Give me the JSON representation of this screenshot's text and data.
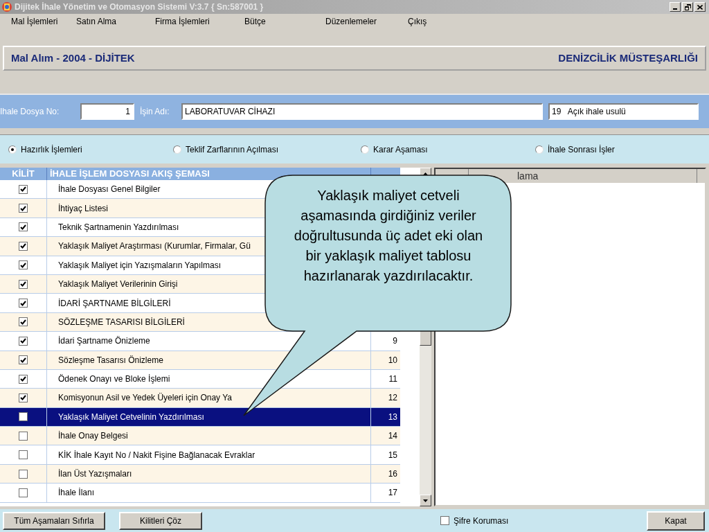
{
  "window": {
    "title": "Dijitek İhale Yönetim ve Otomasyon Sistemi V:3.7 { Sn:587001 }"
  },
  "menu": [
    "Mal İşlemleri",
    "Satın Alma",
    "Firma İşlemleri",
    "Bütçe",
    "Düzenlemeler",
    "Çıkış"
  ],
  "header": {
    "left": "Mal Alım - 2004 - DİJİTEK",
    "right": "DENİZCİLİK MÜSTEŞARLIĞI"
  },
  "fields": [
    {
      "label": "Ihale Dosya No:",
      "value": "1"
    },
    {
      "label": "İşin Adı:",
      "value": "LABORATUVAR CİHAZI"
    },
    {
      "value": "19   Açık ihale usulü"
    }
  ],
  "phases": [
    {
      "label": "Hazırlık İşlemleri",
      "selected": true
    },
    {
      "label": "Teklif Zarflarının Açılması",
      "selected": false
    },
    {
      "label": "Karar Aşaması",
      "selected": false
    },
    {
      "label": "İhale Sonrası İşler",
      "selected": false
    }
  ],
  "table": {
    "columns": [
      "KİLİT",
      "İHALE İŞLEM DOSYASI AKIŞ ŞEMASI"
    ],
    "rows": [
      {
        "checked": true,
        "selected": false,
        "title": "İhale Dosyası Genel Bilgiler"
      },
      {
        "checked": true,
        "selected": false,
        "title": "İhtiyaç Listesi"
      },
      {
        "checked": true,
        "selected": false,
        "title": "Teknik Şartnamenin Yazdırılması"
      },
      {
        "checked": true,
        "selected": false,
        "title": "Yaklaşık Maliyet Araştırması (Kurumlar, Firmalar, Gü"
      },
      {
        "checked": true,
        "selected": false,
        "title": "Yaklaşık Maliyet için Yazışmaların Yapılması"
      },
      {
        "checked": true,
        "selected": false,
        "title": "Yaklaşık Maliyet Verilerinin Girişi"
      },
      {
        "checked": true,
        "selected": false,
        "title": "İDARİ ŞARTNAME BİLGİLERİ"
      },
      {
        "checked": true,
        "selected": false,
        "title": "SÖZLEŞME TASARISI BİLGİLERİ"
      },
      {
        "checked": true,
        "selected": false,
        "title": "İdari Şartname Önizleme",
        "sira": "9"
      },
      {
        "checked": true,
        "selected": false,
        "title": "Sözleşme Tasarısı Önizleme",
        "sira": "10"
      },
      {
        "checked": true,
        "selected": false,
        "title": "Ödenek Onayı ve Bloke İşlemi",
        "sira": "11"
      },
      {
        "checked": true,
        "selected": false,
        "title": "Komisyonun Asil ve Yedek Üyeleri için Onay Ya",
        "sira": "12"
      },
      {
        "checked": false,
        "selected": true,
        "title": "Yaklaşık Maliyet Cetvelinin Yazdırılması",
        "sira": "13"
      },
      {
        "checked": false,
        "selected": false,
        "title": "İhale Onay Belgesi",
        "sira": "14"
      },
      {
        "checked": false,
        "selected": false,
        "title": "KİK İhale Kayıt No / Nakit Fişine Bağlanacak Evraklar",
        "sira": "15"
      },
      {
        "checked": false,
        "selected": false,
        "title": "İlan Üst Yazışmaları",
        "sira": "16"
      },
      {
        "checked": false,
        "selected": false,
        "title": "İhale İlanı",
        "sira": "17"
      }
    ]
  },
  "side_panel": {
    "column_2": "lama"
  },
  "buttons": [
    "Tüm Aşamaları Sıfırla",
    "Kilitleri Çöz"
  ],
  "password": {
    "label": "Şifre Koruması",
    "checked": false
  },
  "close_button": "Kapat",
  "callout": "Yaklaşık maliyet cetveli aşamasında girdiğiniz veriler doğrultusunda üç adet eki olan bir yaklaşık maliyet tablosu hazırlanarak yazdırılacaktır."
}
